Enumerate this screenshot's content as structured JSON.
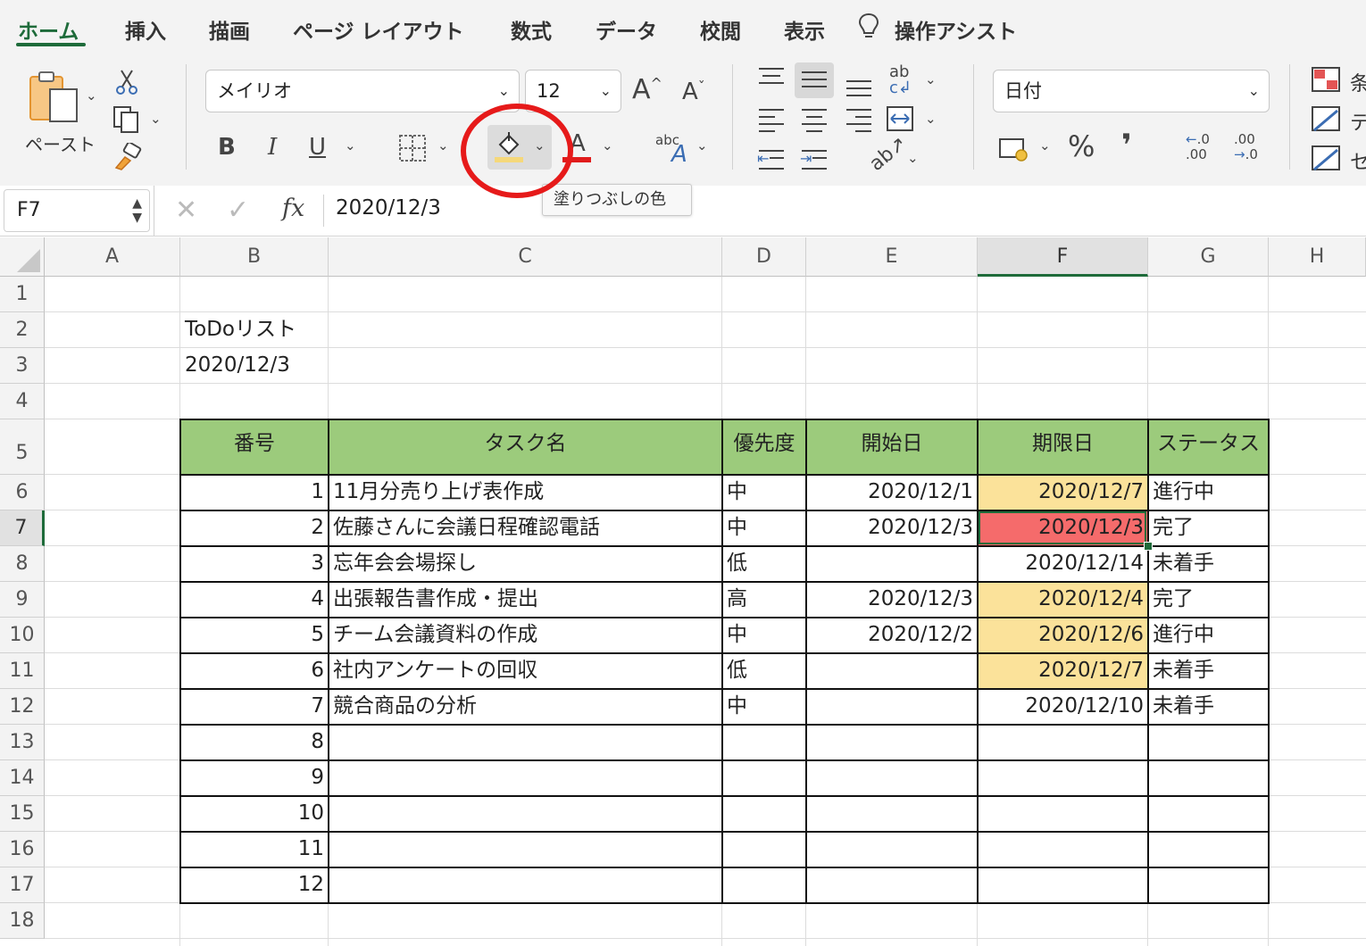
{
  "ribbon": {
    "tabs": [
      "ホーム",
      "挿入",
      "描画",
      "ページ レイアウト",
      "数式",
      "データ",
      "校閲",
      "表示"
    ],
    "assist_label": "操作アシスト",
    "paste_label": "ペースト",
    "font_name": "メイリオ",
    "font_size": "12",
    "grow_font": "A",
    "shrink_font": "A",
    "bold": "B",
    "italic": "I",
    "underline": "U",
    "number_format": "日付",
    "percent": "%",
    "comma": "❜",
    "font_color": "#e01b1b",
    "fill_color": "#f5d87a",
    "right_group_labels": [
      "条",
      "テ",
      "セ"
    ]
  },
  "tooltip": {
    "text": "塗りつぶしの色"
  },
  "formula_bar": {
    "name_box": "F7",
    "fx": "fx",
    "value": "2020/12/3"
  },
  "grid": {
    "columns": [
      "A",
      "B",
      "C",
      "D",
      "E",
      "F",
      "G",
      "H"
    ],
    "rows": [
      "1",
      "2",
      "3",
      "4",
      "5",
      "6",
      "7",
      "8",
      "9",
      "10",
      "11",
      "12",
      "13",
      "14",
      "15",
      "16",
      "17",
      "18"
    ],
    "selected_column": "F",
    "selected_row": "7",
    "title": "ToDoリスト",
    "date": "2020/12/3",
    "table": {
      "headers": [
        "番号",
        "タスク名",
        "優先度",
        "開始日",
        "期限日",
        "ステータス"
      ],
      "header_color": "#9ccb7c",
      "highlight_color": "#fbe29a",
      "alert_color": "#f56b6b",
      "rows": [
        {
          "no": "1",
          "task": "11月分売り上げ表作成",
          "priority": "中",
          "start": "2020/12/1",
          "due": "2020/12/7",
          "status": "進行中",
          "due_fill": "highlight"
        },
        {
          "no": "2",
          "task": "佐藤さんに会議日程確認電話",
          "priority": "中",
          "start": "2020/12/3",
          "due": "2020/12/3",
          "status": "完了",
          "due_fill": "alert"
        },
        {
          "no": "3",
          "task": "忘年会会場探し",
          "priority": "低",
          "start": "",
          "due": "2020/12/14",
          "status": "未着手",
          "due_fill": ""
        },
        {
          "no": "4",
          "task": "出張報告書作成・提出",
          "priority": "高",
          "start": "2020/12/3",
          "due": "2020/12/4",
          "status": "完了",
          "due_fill": "highlight"
        },
        {
          "no": "5",
          "task": "チーム会議資料の作成",
          "priority": "中",
          "start": "2020/12/2",
          "due": "2020/12/6",
          "status": "進行中",
          "due_fill": "highlight"
        },
        {
          "no": "6",
          "task": "社内アンケートの回収",
          "priority": "低",
          "start": "",
          "due": "2020/12/7",
          "status": "未着手",
          "due_fill": "highlight"
        },
        {
          "no": "7",
          "task": "競合商品の分析",
          "priority": "中",
          "start": "",
          "due": "2020/12/10",
          "status": "未着手",
          "due_fill": ""
        },
        {
          "no": "8",
          "task": "",
          "priority": "",
          "start": "",
          "due": "",
          "status": "",
          "due_fill": ""
        },
        {
          "no": "9",
          "task": "",
          "priority": "",
          "start": "",
          "due": "",
          "status": "",
          "due_fill": ""
        },
        {
          "no": "10",
          "task": "",
          "priority": "",
          "start": "",
          "due": "",
          "status": "",
          "due_fill": ""
        },
        {
          "no": "11",
          "task": "",
          "priority": "",
          "start": "",
          "due": "",
          "status": "",
          "due_fill": ""
        },
        {
          "no": "12",
          "task": "",
          "priority": "",
          "start": "",
          "due": "",
          "status": "",
          "due_fill": ""
        }
      ]
    }
  }
}
